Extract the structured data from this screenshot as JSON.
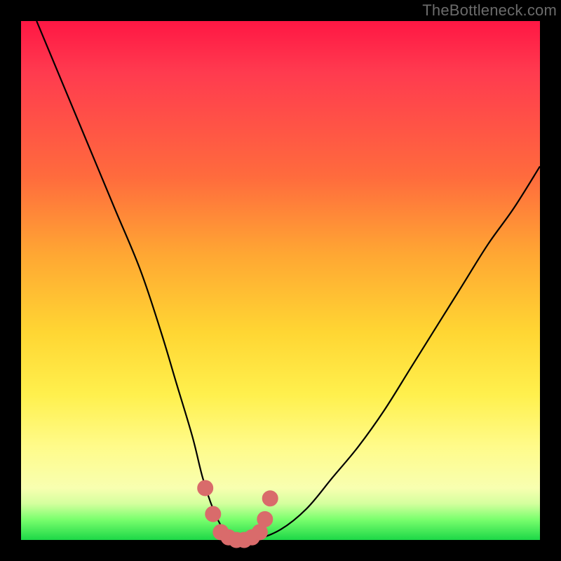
{
  "watermark": "TheBottleneck.com",
  "palette": {
    "curve_stroke": "#000000",
    "marker_fill": "#d96b6b",
    "marker_stroke": "#d96b6b",
    "frame_bg": "#000000"
  },
  "chart_data": {
    "type": "line",
    "title": "",
    "xlabel": "",
    "ylabel": "",
    "xlim": [
      0,
      100
    ],
    "ylim": [
      0,
      100
    ],
    "grid": false,
    "legend": false,
    "series": [
      {
        "name": "bottleneck-curve",
        "x": [
          3,
          8,
          13,
          18,
          23,
          27,
          30,
          33,
          35,
          37,
          39,
          41,
          43,
          45,
          50,
          55,
          60,
          65,
          70,
          75,
          80,
          85,
          90,
          95,
          100
        ],
        "values": [
          100,
          88,
          76,
          64,
          52,
          40,
          30,
          20,
          12,
          6,
          2,
          0,
          0,
          0,
          2,
          6,
          12,
          18,
          25,
          33,
          41,
          49,
          57,
          64,
          72
        ]
      }
    ],
    "markers": [
      {
        "x": 35.5,
        "y": 10
      },
      {
        "x": 37.0,
        "y": 5
      },
      {
        "x": 38.5,
        "y": 1.5
      },
      {
        "x": 40.0,
        "y": 0.5
      },
      {
        "x": 41.5,
        "y": 0
      },
      {
        "x": 43.0,
        "y": 0
      },
      {
        "x": 44.5,
        "y": 0.5
      },
      {
        "x": 46.0,
        "y": 1.5
      },
      {
        "x": 47.0,
        "y": 4
      },
      {
        "x": 48.0,
        "y": 8
      }
    ]
  }
}
